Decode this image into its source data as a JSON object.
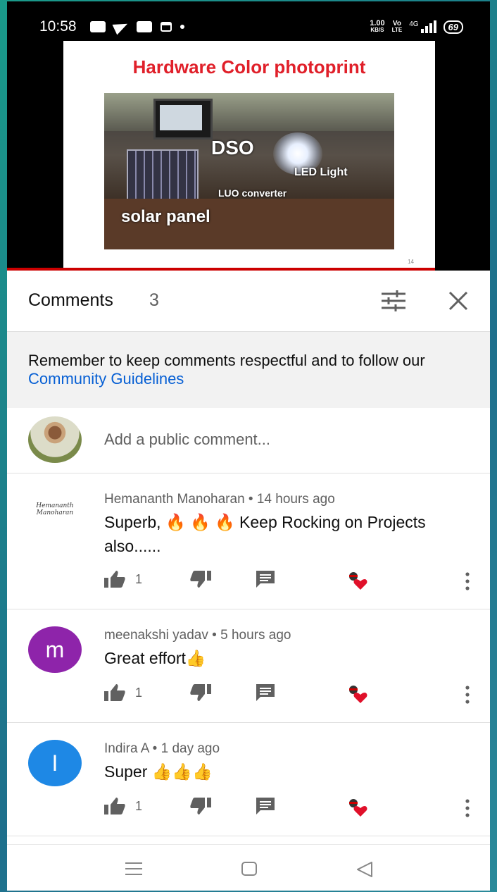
{
  "status_bar": {
    "time": "10:58",
    "net_speed_value": "1.00",
    "net_speed_unit": "KB/S",
    "volte_top": "Vo",
    "volte_bottom": "LTE",
    "network": "4G",
    "battery": "69"
  },
  "video": {
    "slide_title": "Hardware Color photoprint",
    "labels": {
      "dso": "DSO",
      "led": "LED Light",
      "luo": "LUO converter",
      "solar": "solar panel"
    },
    "slide_number": "14"
  },
  "comments_panel": {
    "title": "Comments",
    "count": "3",
    "guidelines_prefix": "Remember to keep comments respectful and to follow our ",
    "guidelines_link": "Community Guidelines",
    "add_placeholder": "Add a public comment..."
  },
  "comments": [
    {
      "author": "Hemananth Manoharan",
      "time": "14 hours ago",
      "avatar_signature": "Hemananth Manoharan",
      "text": "Superb, 🔥 🔥 🔥 Keep Rocking on Projects also......",
      "likes": "1"
    },
    {
      "author": "meenakshi yadav",
      "time": "5 hours ago",
      "avatar_letter": "m",
      "avatar_color": "#8e24aa",
      "text": "Great effort👍",
      "likes": "1"
    },
    {
      "author": "Indira A",
      "time": "1 day ago",
      "avatar_letter": "I",
      "avatar_color": "#1e88e5",
      "text": "Super 👍👍👍",
      "likes": "1"
    }
  ],
  "meta_separator": " • ",
  "icons": {
    "like": "thumbs-up-icon",
    "dislike": "thumbs-down-icon",
    "reply": "reply-icon",
    "creator_heart": "creator-heart-icon",
    "more": "more-vertical-icon",
    "filter": "sort-filter-icon",
    "close": "close-icon"
  },
  "colors": {
    "link": "#065fd4",
    "progress": "#cc0000",
    "heart": "#e0102a"
  }
}
